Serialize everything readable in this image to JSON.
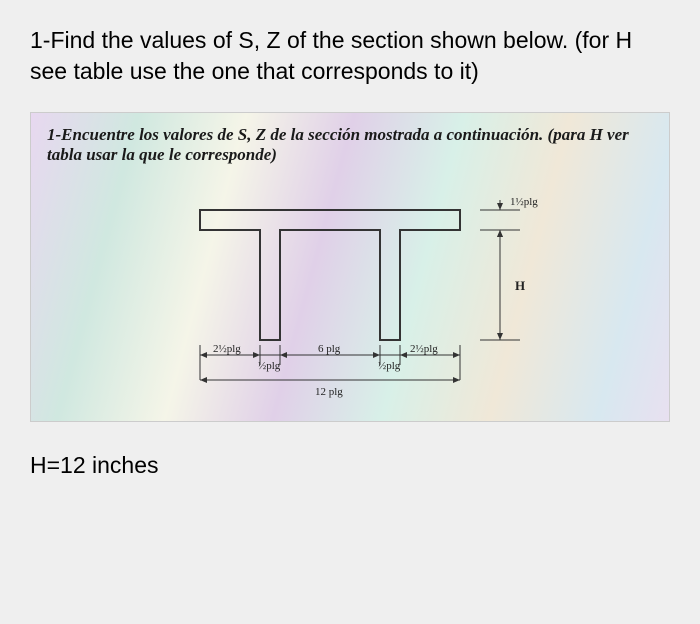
{
  "question": {
    "text": "1-Find the values of S, Z of the section shown below.  (for H see table use the one that corresponds to it)"
  },
  "figure": {
    "header_prefix": "1-Encuentre los valores de S, Z de la sección mostrada a continuación. (para H ver tabla usar la que le corresponde)",
    "dimensions": {
      "top_flange_thickness": "1½plg",
      "height_label": "H",
      "left_outer": "2½plg",
      "web_left": "½plg",
      "middle_gap": "6 plg",
      "right_inner": "2½plg",
      "web_right": "½plg",
      "total_width": "12 plg"
    }
  },
  "footer": {
    "h_value": "H=12 inches"
  }
}
